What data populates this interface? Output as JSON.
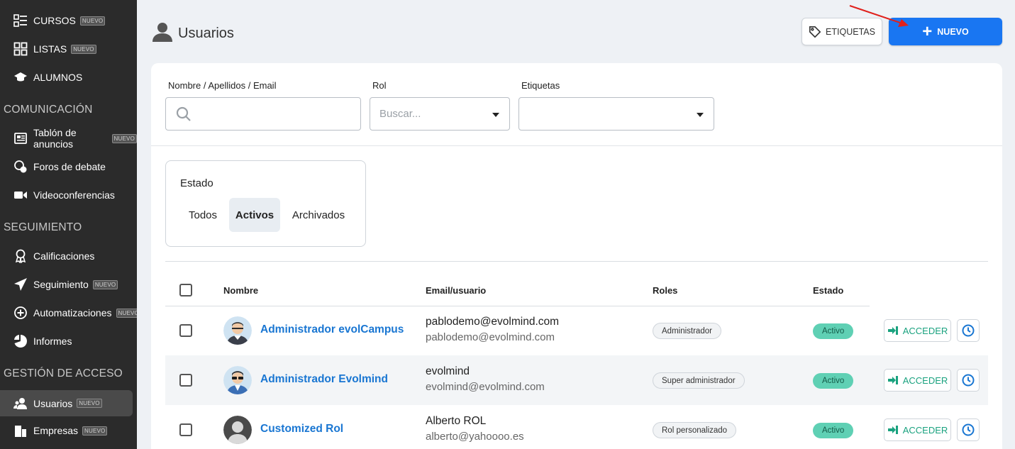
{
  "sidebar": {
    "items": [
      {
        "label": "CURSOS",
        "badge": "NUEVO",
        "icon": "list-icon"
      },
      {
        "label": "LISTAS",
        "badge": "NUEVO",
        "icon": "grid-icon"
      },
      {
        "label": "ALUMNOS",
        "icon": "graduation-cap-icon"
      },
      {
        "label": "Tablón de anuncios",
        "badge": "NUEVO",
        "icon": "newspaper-icon"
      },
      {
        "label": "Foros de debate",
        "icon": "forum-icon"
      },
      {
        "label": "Videoconferencias",
        "icon": "video-icon"
      },
      {
        "label": "Calificaciones",
        "icon": "award-icon"
      },
      {
        "label": "Seguimiento",
        "badge": "NUEVO",
        "icon": "paper-plane-icon"
      },
      {
        "label": "Automatizaciones",
        "badge": "NUEVO",
        "icon": "plus-circle-icon"
      },
      {
        "label": "Informes",
        "icon": "pie-chart-icon"
      },
      {
        "label": "Usuarios",
        "badge": "NUEVO",
        "icon": "users-icon",
        "active": true
      },
      {
        "label": "Empresas",
        "badge": "NUEVO",
        "icon": "building-icon"
      }
    ],
    "sections": [
      "COMUNICACIÓN",
      "SEGUIMIENTO",
      "GESTIÓN DE ACCESO"
    ]
  },
  "header": {
    "title": "Usuarios",
    "etiquetas_label": "ETIQUETAS",
    "nuevo_label": "NUEVO"
  },
  "filters": {
    "name_label": "Nombre / Apellidos / Email",
    "name_value": "",
    "rol_label": "Rol",
    "rol_placeholder": "Buscar...",
    "etiquetas_label": "Etiquetas",
    "etiquetas_value": ""
  },
  "estado": {
    "title": "Estado",
    "options": [
      "Todos",
      "Activos",
      "Archivados"
    ],
    "selected": "Activos"
  },
  "table": {
    "columns": [
      "Nombre",
      "Email/usuario",
      "Roles",
      "Estado"
    ],
    "rows": [
      {
        "name": "Administrador evolCampus",
        "email1": "pablodemo@evolmind.com",
        "email2": "pablodemo@evolmind.com",
        "role": "Administrador",
        "status": "Activo",
        "action": "ACCEDER"
      },
      {
        "name": "Administrador Evolmind",
        "email1": "evolmind",
        "email2": "evolmind@evolmind.com",
        "role": "Super administrador",
        "status": "Activo",
        "action": "ACCEDER"
      },
      {
        "name": "Customized Rol",
        "email1": "Alberto ROL",
        "email2": "alberto@yahoooo.es",
        "role": "Rol personalizado",
        "status": "Activo",
        "action": "ACCEDER"
      }
    ]
  },
  "colors": {
    "sidebar_bg": "#2b2b2b",
    "primary": "#1976f2",
    "link": "#1976d2",
    "status_active": "#5fd0b4",
    "acceder": "#1aa27f",
    "annotation_arrow": "#e0201b"
  }
}
